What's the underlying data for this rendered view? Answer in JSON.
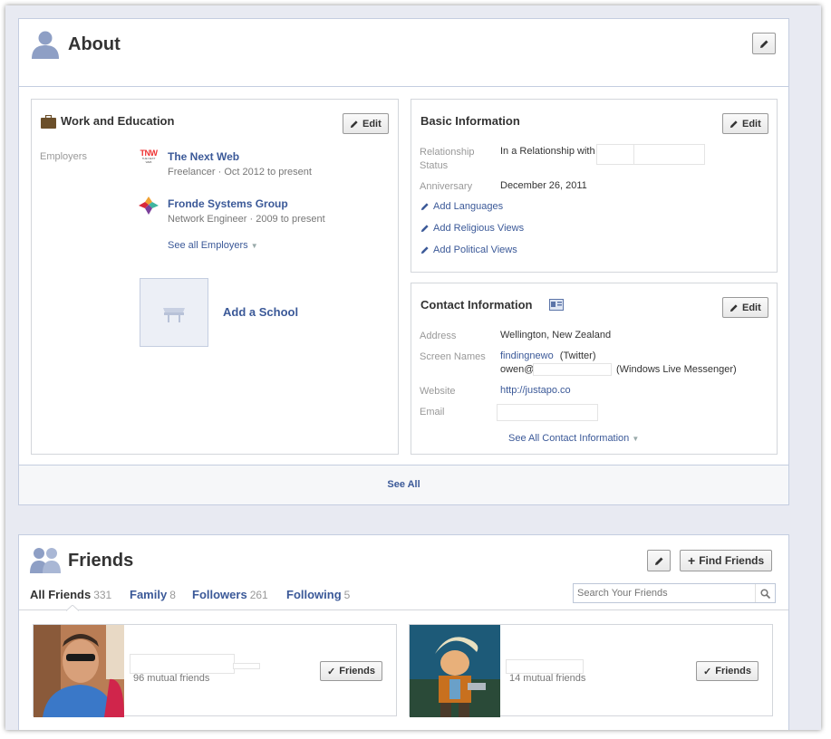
{
  "about": {
    "title": "About",
    "see_all": "See All",
    "work": {
      "title": "Work and Education",
      "edit_label": "Edit",
      "employers_label": "Employers",
      "employers": [
        {
          "name": "The Next Web",
          "detail": "Freelancer · Oct 2012 to present",
          "logo_text": "TNW",
          "logo_sub": "THE NEXT WEB"
        },
        {
          "name": "Fronde Systems Group",
          "detail": "Network Engineer · 2009 to present"
        }
      ],
      "see_all_employers": "See all Employers",
      "add_school": "Add a School"
    },
    "basic": {
      "title": "Basic Information",
      "edit_label": "Edit",
      "relationship_label": "Relationship Status",
      "relationship_value": "In a Relationship with",
      "anniversary_label": "Anniversary",
      "anniversary_value": "December 26, 2011",
      "add_links": [
        "Add Languages",
        "Add Religious Views",
        "Add Political Views"
      ]
    },
    "contact": {
      "title": "Contact Information",
      "edit_label": "Edit",
      "address_label": "Address",
      "address_value": "Wellington, New Zealand",
      "screen_names_label": "Screen Names",
      "twitter_handle": "findingnewo",
      "twitter_service": "(Twitter)",
      "messenger_handle": "owen@",
      "messenger_service": "(Windows Live Messenger)",
      "website_label": "Website",
      "website_value": "http://justapo.co",
      "email_label": "Email",
      "see_all_contact": "See All Contact Information"
    }
  },
  "friends": {
    "title": "Friends",
    "find_friends_label": "Find Friends",
    "tabs": [
      {
        "label": "All Friends",
        "count": "331"
      },
      {
        "label": "Family",
        "count": "8"
      },
      {
        "label": "Followers",
        "count": "261"
      },
      {
        "label": "Following",
        "count": "5"
      }
    ],
    "search_placeholder": "Search Your Friends",
    "cards": [
      {
        "mutual": "96 mutual friends",
        "button": "Friends"
      },
      {
        "mutual": "14 mutual friends",
        "button": "Friends"
      }
    ]
  },
  "colors": {
    "link": "#3b5998",
    "border": "#c4cde0",
    "background": "#e8eaf2"
  }
}
